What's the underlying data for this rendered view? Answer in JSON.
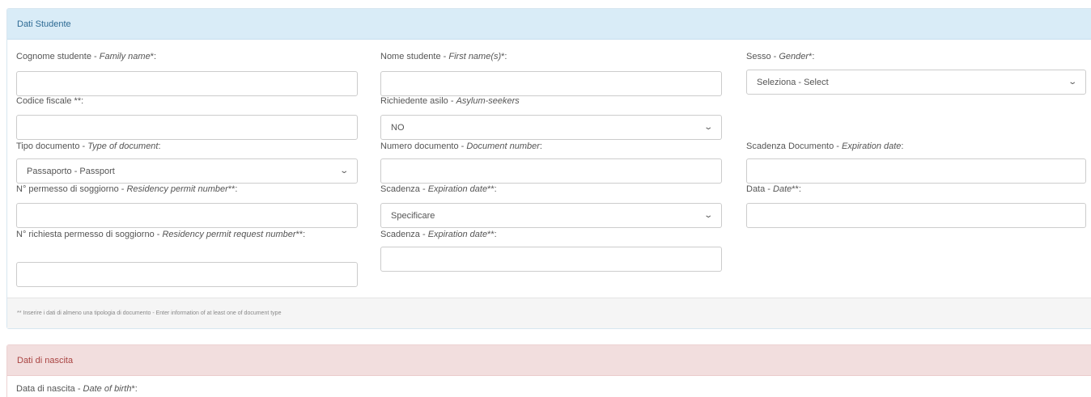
{
  "student_panel": {
    "title": "Dati Studente",
    "footer_note": "** Inserire i dati di almeno una tipologia di documento - Enter information of at least one of document type"
  },
  "fields": {
    "family_name": {
      "label_it": "Cognome studente - ",
      "label_en": "Family name",
      "suffix": "*:",
      "value": ""
    },
    "first_name": {
      "label_it": "Nome studente - ",
      "label_en": "First name(s)",
      "suffix": "*:",
      "value": ""
    },
    "gender": {
      "label_it": "Sesso - ",
      "label_en": "Gender",
      "suffix": "*:",
      "selected": "Seleziona - Select"
    },
    "tax_code": {
      "label_it": "Codice fiscale **:",
      "value": ""
    },
    "asylum": {
      "label_it": "Richiedente asilo - ",
      "label_en": "Asylum-seekers",
      "selected": "NO"
    },
    "doc_type": {
      "label_it": "Tipo documento - ",
      "label_en": "Type of document",
      "suffix": ":",
      "selected": "Passaporto - Passport"
    },
    "doc_number": {
      "label_it": "Numero documento - ",
      "label_en": "Document number",
      "suffix": ":",
      "value": ""
    },
    "doc_expiry": {
      "label_it": "Scadenza Documento - ",
      "label_en": "Expiration date",
      "suffix": ":",
      "value": ""
    },
    "permit_number": {
      "label_it": "N° permesso di soggiorno - ",
      "label_en": "Residency permit number",
      "suffix": "**:",
      "value": ""
    },
    "permit_expiry": {
      "label_it": "Scadenza - ",
      "label_en": "Expiration date",
      "suffix": "**:",
      "selected": "Specificare"
    },
    "permit_date": {
      "label_it": "Data - ",
      "label_en": "Date",
      "suffix": "**:",
      "value": ""
    },
    "request_number": {
      "label_it": "N° richiesta permesso di soggiorno - ",
      "label_en": "Residency permit request number",
      "suffix": "**:",
      "value": ""
    },
    "request_expiry": {
      "label_it": "Scadenza - ",
      "label_en": "Expiration date",
      "suffix": "**:",
      "value": ""
    }
  },
  "birth_panel": {
    "title": "Dati di nascita",
    "dob": {
      "label_it": "Data di nascita - ",
      "label_en": "Date of birth",
      "suffix": "*:"
    }
  },
  "icons": {
    "dropdown": "chevron-down-icon"
  },
  "colors": {
    "info_header": "#d9ecf7",
    "danger_header": "#f2dede"
  }
}
